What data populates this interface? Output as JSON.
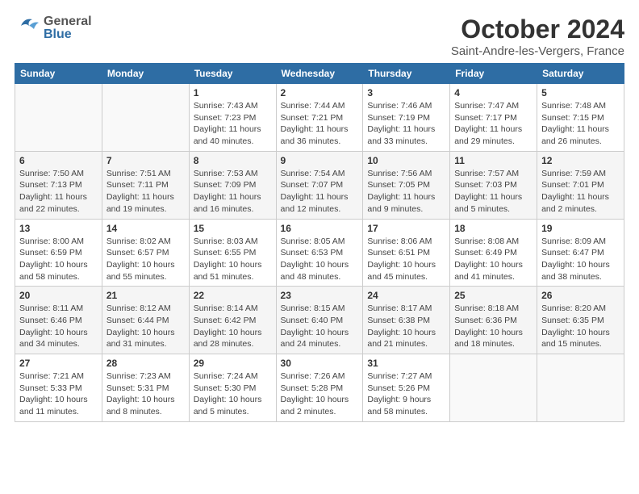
{
  "header": {
    "logo_general": "General",
    "logo_blue": "Blue",
    "month_title": "October 2024",
    "location": "Saint-Andre-les-Vergers, France"
  },
  "days_of_week": [
    "Sunday",
    "Monday",
    "Tuesday",
    "Wednesday",
    "Thursday",
    "Friday",
    "Saturday"
  ],
  "weeks": [
    [
      {
        "day": "",
        "content": ""
      },
      {
        "day": "",
        "content": ""
      },
      {
        "day": "1",
        "content": "Sunrise: 7:43 AM\nSunset: 7:23 PM\nDaylight: 11 hours and 40 minutes."
      },
      {
        "day": "2",
        "content": "Sunrise: 7:44 AM\nSunset: 7:21 PM\nDaylight: 11 hours and 36 minutes."
      },
      {
        "day": "3",
        "content": "Sunrise: 7:46 AM\nSunset: 7:19 PM\nDaylight: 11 hours and 33 minutes."
      },
      {
        "day": "4",
        "content": "Sunrise: 7:47 AM\nSunset: 7:17 PM\nDaylight: 11 hours and 29 minutes."
      },
      {
        "day": "5",
        "content": "Sunrise: 7:48 AM\nSunset: 7:15 PM\nDaylight: 11 hours and 26 minutes."
      }
    ],
    [
      {
        "day": "6",
        "content": "Sunrise: 7:50 AM\nSunset: 7:13 PM\nDaylight: 11 hours and 22 minutes."
      },
      {
        "day": "7",
        "content": "Sunrise: 7:51 AM\nSunset: 7:11 PM\nDaylight: 11 hours and 19 minutes."
      },
      {
        "day": "8",
        "content": "Sunrise: 7:53 AM\nSunset: 7:09 PM\nDaylight: 11 hours and 16 minutes."
      },
      {
        "day": "9",
        "content": "Sunrise: 7:54 AM\nSunset: 7:07 PM\nDaylight: 11 hours and 12 minutes."
      },
      {
        "day": "10",
        "content": "Sunrise: 7:56 AM\nSunset: 7:05 PM\nDaylight: 11 hours and 9 minutes."
      },
      {
        "day": "11",
        "content": "Sunrise: 7:57 AM\nSunset: 7:03 PM\nDaylight: 11 hours and 5 minutes."
      },
      {
        "day": "12",
        "content": "Sunrise: 7:59 AM\nSunset: 7:01 PM\nDaylight: 11 hours and 2 minutes."
      }
    ],
    [
      {
        "day": "13",
        "content": "Sunrise: 8:00 AM\nSunset: 6:59 PM\nDaylight: 10 hours and 58 minutes."
      },
      {
        "day": "14",
        "content": "Sunrise: 8:02 AM\nSunset: 6:57 PM\nDaylight: 10 hours and 55 minutes."
      },
      {
        "day": "15",
        "content": "Sunrise: 8:03 AM\nSunset: 6:55 PM\nDaylight: 10 hours and 51 minutes."
      },
      {
        "day": "16",
        "content": "Sunrise: 8:05 AM\nSunset: 6:53 PM\nDaylight: 10 hours and 48 minutes."
      },
      {
        "day": "17",
        "content": "Sunrise: 8:06 AM\nSunset: 6:51 PM\nDaylight: 10 hours and 45 minutes."
      },
      {
        "day": "18",
        "content": "Sunrise: 8:08 AM\nSunset: 6:49 PM\nDaylight: 10 hours and 41 minutes."
      },
      {
        "day": "19",
        "content": "Sunrise: 8:09 AM\nSunset: 6:47 PM\nDaylight: 10 hours and 38 minutes."
      }
    ],
    [
      {
        "day": "20",
        "content": "Sunrise: 8:11 AM\nSunset: 6:46 PM\nDaylight: 10 hours and 34 minutes."
      },
      {
        "day": "21",
        "content": "Sunrise: 8:12 AM\nSunset: 6:44 PM\nDaylight: 10 hours and 31 minutes."
      },
      {
        "day": "22",
        "content": "Sunrise: 8:14 AM\nSunset: 6:42 PM\nDaylight: 10 hours and 28 minutes."
      },
      {
        "day": "23",
        "content": "Sunrise: 8:15 AM\nSunset: 6:40 PM\nDaylight: 10 hours and 24 minutes."
      },
      {
        "day": "24",
        "content": "Sunrise: 8:17 AM\nSunset: 6:38 PM\nDaylight: 10 hours and 21 minutes."
      },
      {
        "day": "25",
        "content": "Sunrise: 8:18 AM\nSunset: 6:36 PM\nDaylight: 10 hours and 18 minutes."
      },
      {
        "day": "26",
        "content": "Sunrise: 8:20 AM\nSunset: 6:35 PM\nDaylight: 10 hours and 15 minutes."
      }
    ],
    [
      {
        "day": "27",
        "content": "Sunrise: 7:21 AM\nSunset: 5:33 PM\nDaylight: 10 hours and 11 minutes."
      },
      {
        "day": "28",
        "content": "Sunrise: 7:23 AM\nSunset: 5:31 PM\nDaylight: 10 hours and 8 minutes."
      },
      {
        "day": "29",
        "content": "Sunrise: 7:24 AM\nSunset: 5:30 PM\nDaylight: 10 hours and 5 minutes."
      },
      {
        "day": "30",
        "content": "Sunrise: 7:26 AM\nSunset: 5:28 PM\nDaylight: 10 hours and 2 minutes."
      },
      {
        "day": "31",
        "content": "Sunrise: 7:27 AM\nSunset: 5:26 PM\nDaylight: 9 hours and 58 minutes."
      },
      {
        "day": "",
        "content": ""
      },
      {
        "day": "",
        "content": ""
      }
    ]
  ]
}
